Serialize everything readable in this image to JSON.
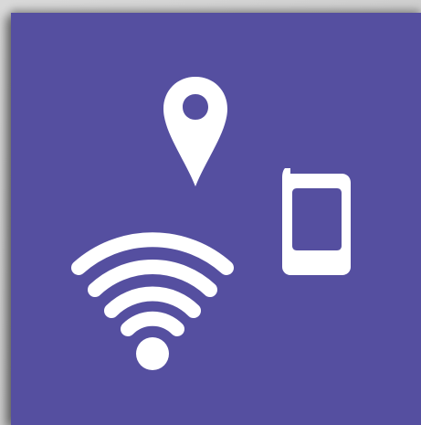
{
  "tile": {
    "background_color": "#554fa0",
    "icon_color": "#ffffff"
  },
  "icons": {
    "location": "location-pin-icon",
    "phone": "mobile-phone-icon",
    "wifi": "wifi-signal-icon"
  }
}
